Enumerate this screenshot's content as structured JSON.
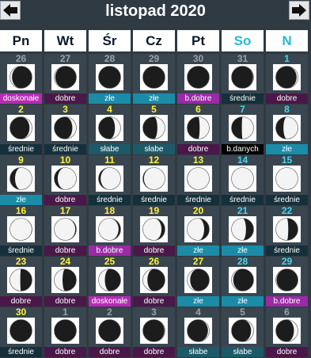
{
  "calendar": {
    "title": "listopad 2020",
    "nav": {
      "prev_icon": "arrow-left-icon",
      "next_icon": "arrow-right-icon"
    },
    "weekdays": [
      "Pn",
      "Wt",
      "Śr",
      "Cz",
      "Pt",
      "So",
      "N"
    ],
    "colors": {
      "background": "#2f3a43",
      "cell": "#3a464f",
      "weekday_number": "#ffef44",
      "weekend_number": "#46d6ef",
      "other_month_number": "#9aa3ab",
      "doskonale": "#b82ab4",
      "b.dobre": "#9a2aa6",
      "dobre": "#4a1848",
      "średnie": "#15303a",
      "złe": "#1a8ca8",
      "słabe": "#1d5a68",
      "b.danych": "#000000"
    },
    "weeks": [
      [
        {
          "day": "26",
          "month": "prev",
          "rating": "doskonałe",
          "rating_key": "doskonale",
          "phase": 0.9
        },
        {
          "day": "27",
          "month": "prev",
          "rating": "dobre",
          "rating_key": "dobre",
          "phase": 0.93
        },
        {
          "day": "28",
          "month": "prev",
          "rating": "złe",
          "rating_key": "zle",
          "phase": 0.96
        },
        {
          "day": "29",
          "month": "prev",
          "rating": "złe",
          "rating_key": "zle",
          "phase": 0.99
        },
        {
          "day": "30",
          "month": "prev",
          "rating": "b.dobre",
          "rating_key": "bdobre",
          "phase": 0.02
        },
        {
          "day": "31",
          "month": "prev",
          "rating": "średnie",
          "rating_key": "srednie",
          "phase": 0.05
        },
        {
          "day": "1",
          "month": "cur",
          "rating": "dobre",
          "rating_key": "dobre",
          "phase": 0.08
        }
      ],
      [
        {
          "day": "2",
          "month": "cur",
          "rating": "średnie",
          "rating_key": "srednie",
          "phase": 0.11
        },
        {
          "day": "3",
          "month": "cur",
          "rating": "średnie",
          "rating_key": "srednie",
          "phase": 0.14
        },
        {
          "day": "4",
          "month": "cur",
          "rating": "słabe",
          "rating_key": "slabe",
          "phase": 0.17
        },
        {
          "day": "5",
          "month": "cur",
          "rating": "słabe",
          "rating_key": "slabe",
          "phase": 0.2
        },
        {
          "day": "6",
          "month": "cur",
          "rating": "dobre",
          "rating_key": "dobre",
          "phase": 0.23
        },
        {
          "day": "7",
          "month": "cur",
          "rating": "b.danych",
          "rating_key": "bdanych",
          "phase": 0.26
        },
        {
          "day": "8",
          "month": "cur",
          "rating": "złe",
          "rating_key": "zle",
          "phase": 0.3
        }
      ],
      [
        {
          "day": "9",
          "month": "cur",
          "rating": "złe",
          "rating_key": "zle",
          "phase": 0.34
        },
        {
          "day": "10",
          "month": "cur",
          "rating": "dobre",
          "rating_key": "dobre",
          "phase": 0.37
        },
        {
          "day": "11",
          "month": "cur",
          "rating": "średnie",
          "rating_key": "srednie",
          "phase": 0.4
        },
        {
          "day": "12",
          "month": "cur",
          "rating": "średnie",
          "rating_key": "srednie",
          "phase": 0.43
        },
        {
          "day": "13",
          "month": "cur",
          "rating": "średnie",
          "rating_key": "srednie",
          "phase": 0.46
        },
        {
          "day": "14",
          "month": "cur",
          "rating": "średnie",
          "rating_key": "srednie",
          "phase": 0.49
        },
        {
          "day": "15",
          "month": "cur",
          "rating": "średnie",
          "rating_key": "srednie",
          "phase": 0.51
        }
      ],
      [
        {
          "day": "16",
          "month": "cur",
          "rating": "średnie",
          "rating_key": "srednie",
          "phase": 0.54
        },
        {
          "day": "17",
          "month": "cur",
          "rating": "dobre",
          "rating_key": "dobre",
          "phase": 0.57
        },
        {
          "day": "18",
          "month": "cur",
          "rating": "b.dobre",
          "rating_key": "bdobre",
          "phase": 0.6
        },
        {
          "day": "19",
          "month": "cur",
          "rating": "dobre",
          "rating_key": "dobre",
          "phase": 0.63
        },
        {
          "day": "20",
          "month": "cur",
          "rating": "złe",
          "rating_key": "zle",
          "phase": 0.66
        },
        {
          "day": "21",
          "month": "cur",
          "rating": "złe",
          "rating_key": "zle",
          "phase": 0.7
        },
        {
          "day": "22",
          "month": "cur",
          "rating": "średnie",
          "rating_key": "srednie",
          "phase": 0.73
        }
      ],
      [
        {
          "day": "23",
          "month": "cur",
          "rating": "dobre",
          "rating_key": "dobre",
          "phase": 0.76
        },
        {
          "day": "24",
          "month": "cur",
          "rating": "dobre",
          "rating_key": "dobre",
          "phase": 0.79
        },
        {
          "day": "25",
          "month": "cur",
          "rating": "doskonałe",
          "rating_key": "doskonale",
          "phase": 0.82
        },
        {
          "day": "26",
          "month": "cur",
          "rating": "dobre",
          "rating_key": "dobre",
          "phase": 0.85
        },
        {
          "day": "27",
          "month": "cur",
          "rating": "złe",
          "rating_key": "zle",
          "phase": 0.88
        },
        {
          "day": "28",
          "month": "cur",
          "rating": "złe",
          "rating_key": "zle",
          "phase": 0.91
        },
        {
          "day": "29",
          "month": "cur",
          "rating": "b.dobre",
          "rating_key": "bdobre",
          "phase": 0.94
        }
      ],
      [
        {
          "day": "30",
          "month": "cur",
          "rating": "średnie",
          "rating_key": "srednie",
          "phase": 0.97
        },
        {
          "day": "1",
          "month": "next",
          "rating": "dobre",
          "rating_key": "dobre",
          "phase": 0.99
        },
        {
          "day": "2",
          "month": "next",
          "rating": "dobre",
          "rating_key": "dobre",
          "phase": 0.02
        },
        {
          "day": "3",
          "month": "next",
          "rating": "dobre",
          "rating_key": "dobre",
          "phase": 0.05
        },
        {
          "day": "4",
          "month": "next",
          "rating": "słabe",
          "rating_key": "slabe",
          "phase": 0.08
        },
        {
          "day": "5",
          "month": "next",
          "rating": "słabe",
          "rating_key": "slabe",
          "phase": 0.11
        },
        {
          "day": "6",
          "month": "next",
          "rating": "dobre",
          "rating_key": "dobre",
          "phase": 0.14
        }
      ]
    ]
  }
}
